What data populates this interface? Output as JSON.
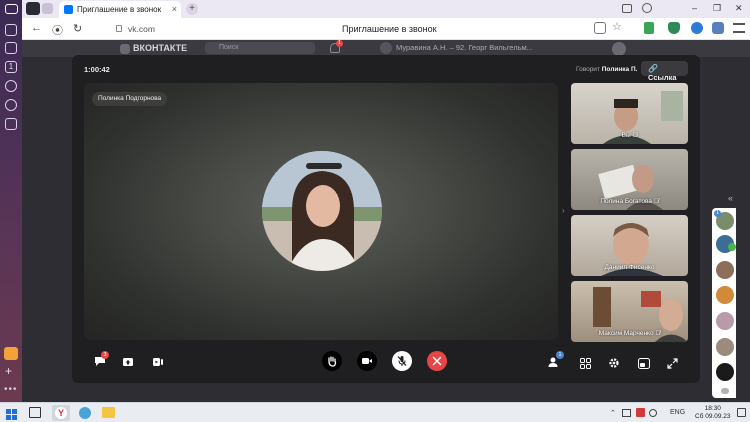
{
  "browser": {
    "tab_title": "Приглашение в звонок",
    "tab_close": "×",
    "new_tab": "+",
    "url_host": "vk.com",
    "page_title": "Приглашение в звонок",
    "window_controls": {
      "minimize": "–",
      "restore": "❐",
      "close": "✕"
    },
    "nav": {
      "back": "←",
      "forward": "→",
      "reload": "↻",
      "shield": "⦿"
    },
    "address_icons": [
      "translate-icon",
      "star-icon",
      "download-icon",
      "adblock-icon",
      "vpn-icon",
      "extension-icon"
    ]
  },
  "vk": {
    "logo_text": "ВКОНТАКТЕ",
    "search_placeholder": "Поиск",
    "notification_text": "Муравина А.Н. – 92. Георг Вильгельм...",
    "notification_badge": "1"
  },
  "call": {
    "timer": "1:00:42",
    "speaking_label": "Говорит",
    "speaking_name": "Полинка П.",
    "link_button": "Ссылка",
    "main_participant": "Полинка Подгорнова",
    "participants": [
      {
        "label": "Вы",
        "muted": true
      },
      {
        "label": "Полина Богатова",
        "muted": true
      },
      {
        "label": "Даниил Фисенко",
        "muted": false
      },
      {
        "label": "Максим Марченко",
        "muted": true
      }
    ],
    "chat_badge": "3",
    "participants_badge": "1",
    "controls": {
      "left": [
        "chat-icon",
        "share-screen-icon",
        "broadcast-icon"
      ],
      "center": [
        "raise-hand-icon",
        "camera-icon",
        "mic-muted-icon",
        "end-call-icon"
      ],
      "right": [
        "participants-icon",
        "layout-grid-icon",
        "settings-icon",
        "pip-icon",
        "fullscreen-icon"
      ]
    },
    "colors": {
      "end_call": "#e64646",
      "mic_button": "#ffffff",
      "badge": "#4986cc"
    }
  },
  "sidebar": {
    "collapse": "«",
    "badge": "1"
  },
  "taskbar": {
    "lang": "ENG",
    "time": "18:30",
    "date": "Сб 09.09.23"
  }
}
